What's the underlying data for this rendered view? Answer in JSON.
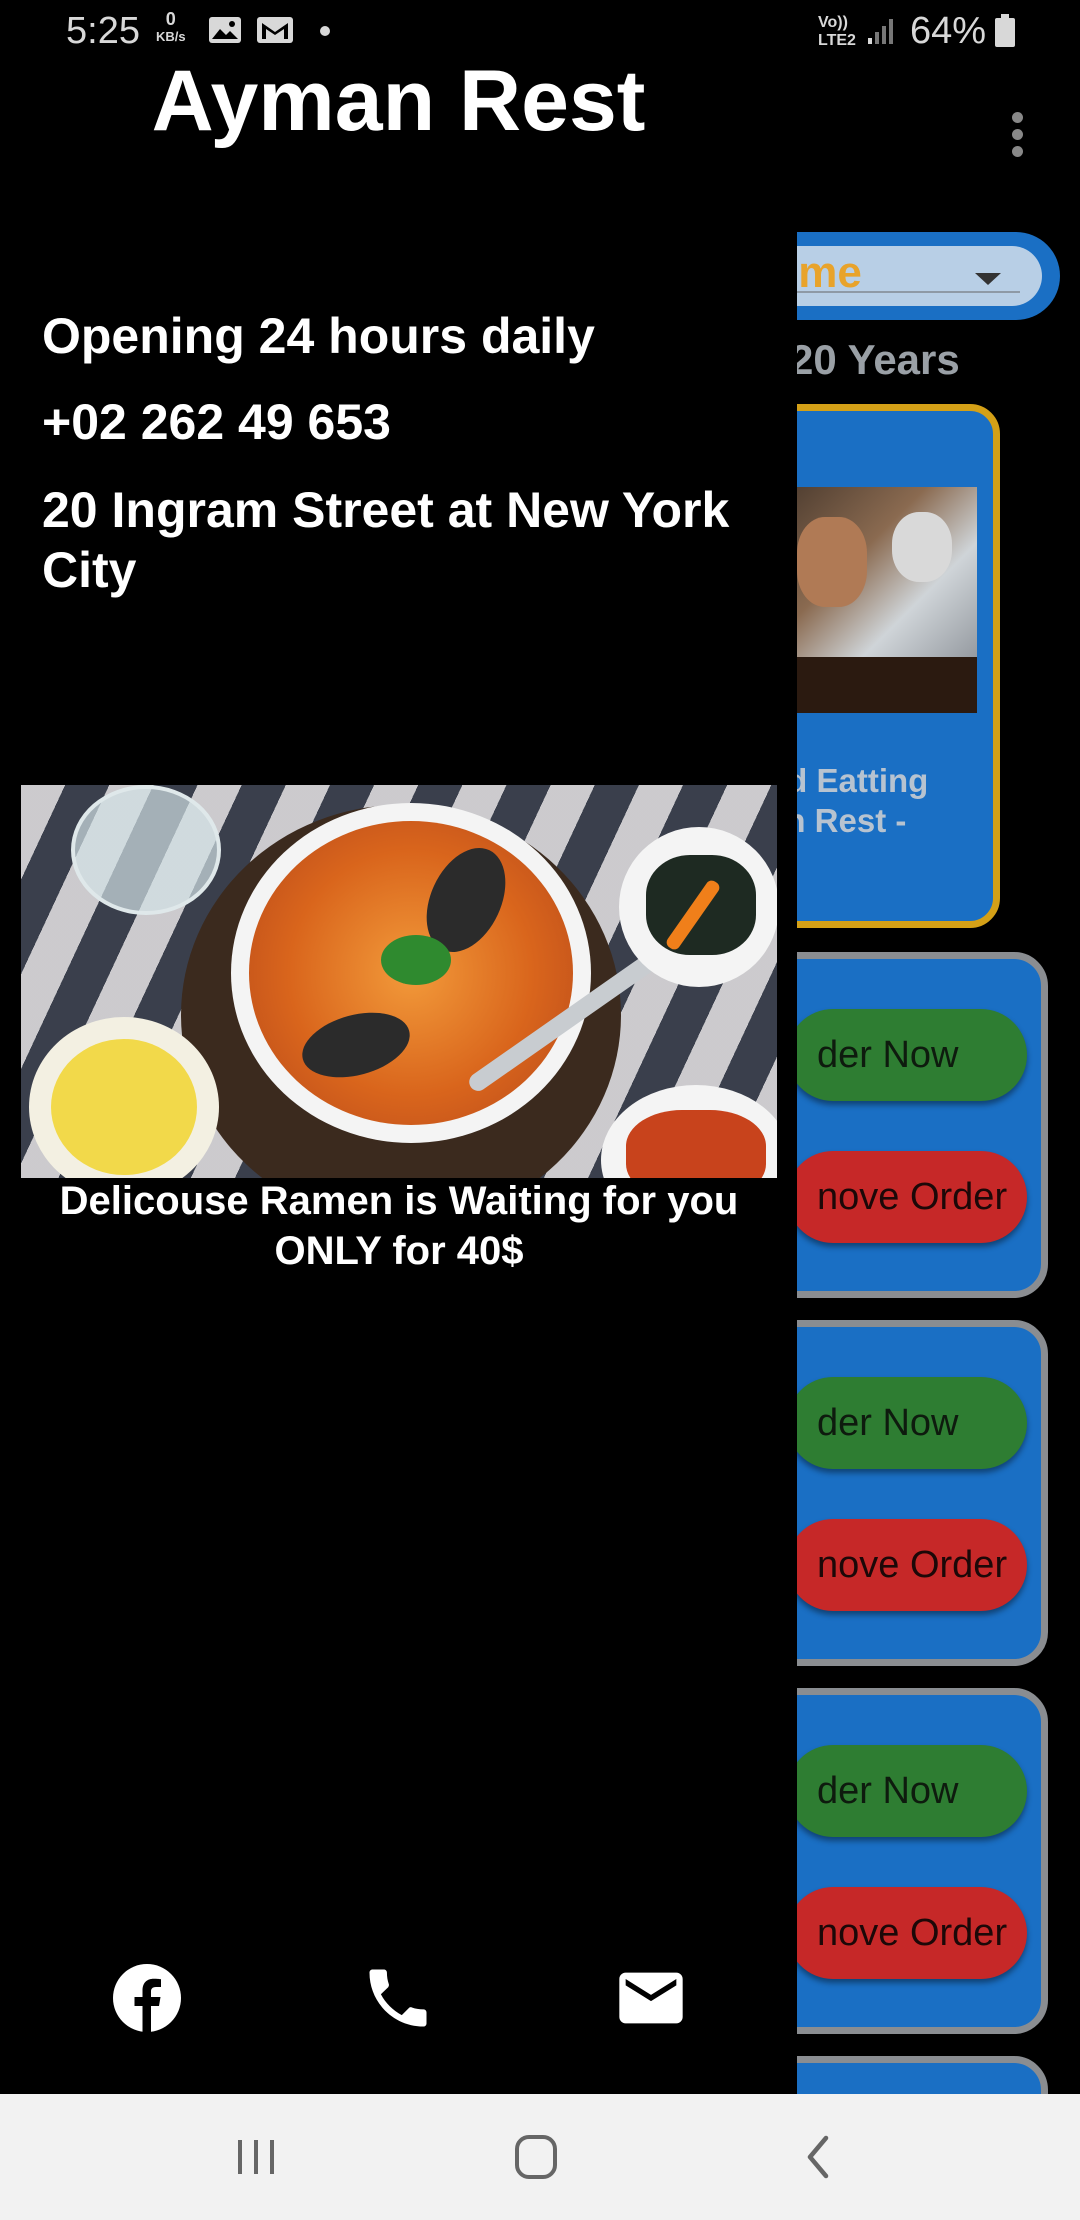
{
  "status_bar": {
    "time": "5:25",
    "data_rate_value": "0",
    "data_rate_unit": "KB/s",
    "network_label_top": "Vo))",
    "network_label_bottom": "LTE2",
    "battery": "64%"
  },
  "background_app": {
    "theme_dropdown": "Theme",
    "years_text": "20 Years",
    "promo_caption_line1": "nd Eatting",
    "promo_caption_line2": "an Rest -",
    "order_cards": [
      {
        "order_now": "der Now",
        "remove_order": "nove Order"
      },
      {
        "order_now": "der Now",
        "remove_order": "nove Order"
      },
      {
        "order_now": "der Now",
        "remove_order": "nove Order"
      }
    ]
  },
  "drawer": {
    "title": "Ayman Rest",
    "hours": "Opening 24 hours daily",
    "phone": "+02 262 49 653",
    "address": "20 Ingram Street at New York City",
    "food_caption": "Delicouse Ramen is Waiting for you ONLY for 40$",
    "social": {
      "facebook_icon": "facebook-icon",
      "phone_icon": "phone-icon",
      "mail_icon": "mail-icon"
    }
  },
  "nav_bar": {
    "recents_icon": "recents-icon",
    "home_icon": "home-icon",
    "back_icon": "back-icon"
  },
  "colors": {
    "drawer_bg": "#000000",
    "card_blue": "#1a6fc4",
    "order_green": "#2e7d32",
    "remove_red": "#c62828",
    "promo_border": "#d4a017",
    "theme_text": "#e8a32b"
  }
}
